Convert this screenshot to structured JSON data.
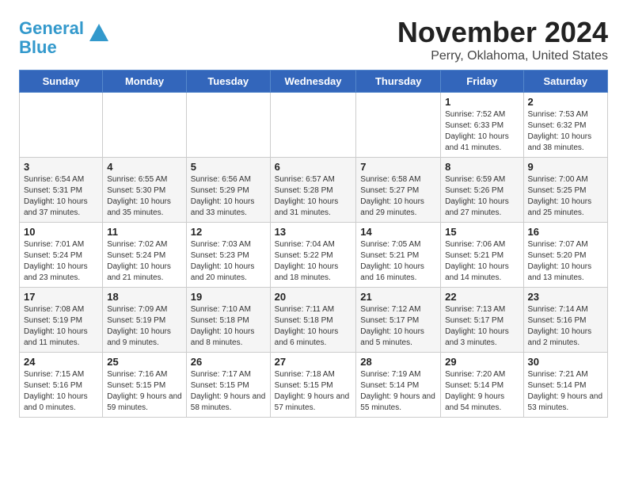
{
  "logo": {
    "line1": "General",
    "line2": "Blue"
  },
  "title": "November 2024",
  "subtitle": "Perry, Oklahoma, United States",
  "weekdays": [
    "Sunday",
    "Monday",
    "Tuesday",
    "Wednesday",
    "Thursday",
    "Friday",
    "Saturday"
  ],
  "weeks": [
    [
      {
        "day": "",
        "info": ""
      },
      {
        "day": "",
        "info": ""
      },
      {
        "day": "",
        "info": ""
      },
      {
        "day": "",
        "info": ""
      },
      {
        "day": "",
        "info": ""
      },
      {
        "day": "1",
        "info": "Sunrise: 7:52 AM\nSunset: 6:33 PM\nDaylight: 10 hours and 41 minutes."
      },
      {
        "day": "2",
        "info": "Sunrise: 7:53 AM\nSunset: 6:32 PM\nDaylight: 10 hours and 38 minutes."
      }
    ],
    [
      {
        "day": "3",
        "info": "Sunrise: 6:54 AM\nSunset: 5:31 PM\nDaylight: 10 hours and 37 minutes."
      },
      {
        "day": "4",
        "info": "Sunrise: 6:55 AM\nSunset: 5:30 PM\nDaylight: 10 hours and 35 minutes."
      },
      {
        "day": "5",
        "info": "Sunrise: 6:56 AM\nSunset: 5:29 PM\nDaylight: 10 hours and 33 minutes."
      },
      {
        "day": "6",
        "info": "Sunrise: 6:57 AM\nSunset: 5:28 PM\nDaylight: 10 hours and 31 minutes."
      },
      {
        "day": "7",
        "info": "Sunrise: 6:58 AM\nSunset: 5:27 PM\nDaylight: 10 hours and 29 minutes."
      },
      {
        "day": "8",
        "info": "Sunrise: 6:59 AM\nSunset: 5:26 PM\nDaylight: 10 hours and 27 minutes."
      },
      {
        "day": "9",
        "info": "Sunrise: 7:00 AM\nSunset: 5:25 PM\nDaylight: 10 hours and 25 minutes."
      }
    ],
    [
      {
        "day": "10",
        "info": "Sunrise: 7:01 AM\nSunset: 5:24 PM\nDaylight: 10 hours and 23 minutes."
      },
      {
        "day": "11",
        "info": "Sunrise: 7:02 AM\nSunset: 5:24 PM\nDaylight: 10 hours and 21 minutes."
      },
      {
        "day": "12",
        "info": "Sunrise: 7:03 AM\nSunset: 5:23 PM\nDaylight: 10 hours and 20 minutes."
      },
      {
        "day": "13",
        "info": "Sunrise: 7:04 AM\nSunset: 5:22 PM\nDaylight: 10 hours and 18 minutes."
      },
      {
        "day": "14",
        "info": "Sunrise: 7:05 AM\nSunset: 5:21 PM\nDaylight: 10 hours and 16 minutes."
      },
      {
        "day": "15",
        "info": "Sunrise: 7:06 AM\nSunset: 5:21 PM\nDaylight: 10 hours and 14 minutes."
      },
      {
        "day": "16",
        "info": "Sunrise: 7:07 AM\nSunset: 5:20 PM\nDaylight: 10 hours and 13 minutes."
      }
    ],
    [
      {
        "day": "17",
        "info": "Sunrise: 7:08 AM\nSunset: 5:19 PM\nDaylight: 10 hours and 11 minutes."
      },
      {
        "day": "18",
        "info": "Sunrise: 7:09 AM\nSunset: 5:19 PM\nDaylight: 10 hours and 9 minutes."
      },
      {
        "day": "19",
        "info": "Sunrise: 7:10 AM\nSunset: 5:18 PM\nDaylight: 10 hours and 8 minutes."
      },
      {
        "day": "20",
        "info": "Sunrise: 7:11 AM\nSunset: 5:18 PM\nDaylight: 10 hours and 6 minutes."
      },
      {
        "day": "21",
        "info": "Sunrise: 7:12 AM\nSunset: 5:17 PM\nDaylight: 10 hours and 5 minutes."
      },
      {
        "day": "22",
        "info": "Sunrise: 7:13 AM\nSunset: 5:17 PM\nDaylight: 10 hours and 3 minutes."
      },
      {
        "day": "23",
        "info": "Sunrise: 7:14 AM\nSunset: 5:16 PM\nDaylight: 10 hours and 2 minutes."
      }
    ],
    [
      {
        "day": "24",
        "info": "Sunrise: 7:15 AM\nSunset: 5:16 PM\nDaylight: 10 hours and 0 minutes."
      },
      {
        "day": "25",
        "info": "Sunrise: 7:16 AM\nSunset: 5:15 PM\nDaylight: 9 hours and 59 minutes."
      },
      {
        "day": "26",
        "info": "Sunrise: 7:17 AM\nSunset: 5:15 PM\nDaylight: 9 hours and 58 minutes."
      },
      {
        "day": "27",
        "info": "Sunrise: 7:18 AM\nSunset: 5:15 PM\nDaylight: 9 hours and 57 minutes."
      },
      {
        "day": "28",
        "info": "Sunrise: 7:19 AM\nSunset: 5:14 PM\nDaylight: 9 hours and 55 minutes."
      },
      {
        "day": "29",
        "info": "Sunrise: 7:20 AM\nSunset: 5:14 PM\nDaylight: 9 hours and 54 minutes."
      },
      {
        "day": "30",
        "info": "Sunrise: 7:21 AM\nSunset: 5:14 PM\nDaylight: 9 hours and 53 minutes."
      }
    ]
  ]
}
